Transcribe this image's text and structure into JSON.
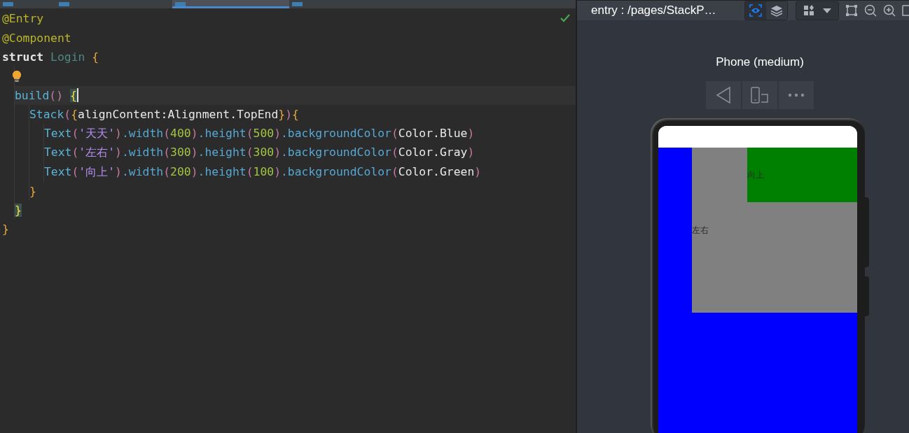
{
  "editor_tabs": [
    {
      "selected": false
    },
    {
      "selected": false
    },
    {
      "selected": true
    },
    {
      "selected": false
    }
  ],
  "code": {
    "valid": true,
    "lines": [
      {
        "tokens": [
          {
            "kind": "decorator",
            "text": "@Entry"
          }
        ]
      },
      {
        "tokens": [
          {
            "kind": "decorator",
            "text": "@Component"
          }
        ]
      },
      {
        "tokens": [
          {
            "kind": "keyword",
            "text": "struct "
          },
          {
            "kind": "type",
            "text": "Login "
          },
          {
            "kind": "brace",
            "text": "{"
          }
        ],
        "children": [
          {
            "kind": "hint"
          },
          {
            "current": true,
            "cursor": true,
            "tokens": [
              {
                "kind": "func",
                "text": "build"
              },
              {
                "kind": "paren",
                "text": "() "
              },
              {
                "kind": "match",
                "text": "{"
              }
            ],
            "children": [
              {
                "tokens": [
                  {
                    "kind": "func",
                    "text": "Stack"
                  },
                  {
                    "kind": "paren",
                    "text": "("
                  },
                  {
                    "kind": "brace",
                    "text": "{"
                  },
                  {
                    "kind": "plain",
                    "text": "alignContent:Alignment.TopEnd"
                  },
                  {
                    "kind": "brace",
                    "text": "}"
                  },
                  {
                    "kind": "paren",
                    "text": ")"
                  },
                  {
                    "kind": "brace",
                    "text": "{"
                  }
                ],
                "children": [
                  {
                    "tokens": [
                      {
                        "kind": "func",
                        "text": "Text"
                      },
                      {
                        "kind": "paren",
                        "text": "("
                      },
                      {
                        "kind": "string",
                        "text": "'天天'"
                      },
                      {
                        "kind": "paren",
                        "text": ")"
                      },
                      {
                        "kind": "method",
                        "text": ".width"
                      },
                      {
                        "kind": "paren",
                        "text": "("
                      },
                      {
                        "kind": "number",
                        "text": "400"
                      },
                      {
                        "kind": "paren",
                        "text": ")"
                      },
                      {
                        "kind": "method",
                        "text": ".height"
                      },
                      {
                        "kind": "paren",
                        "text": "("
                      },
                      {
                        "kind": "number",
                        "text": "500"
                      },
                      {
                        "kind": "paren",
                        "text": ")"
                      },
                      {
                        "kind": "method",
                        "text": ".backgroundColor"
                      },
                      {
                        "kind": "paren",
                        "text": "("
                      },
                      {
                        "kind": "plain",
                        "text": "Color.Blue"
                      },
                      {
                        "kind": "paren",
                        "text": ")"
                      }
                    ]
                  },
                  {
                    "tokens": [
                      {
                        "kind": "func",
                        "text": "Text"
                      },
                      {
                        "kind": "paren",
                        "text": "("
                      },
                      {
                        "kind": "string",
                        "text": "'左右'"
                      },
                      {
                        "kind": "paren",
                        "text": ")"
                      },
                      {
                        "kind": "method",
                        "text": ".width"
                      },
                      {
                        "kind": "paren",
                        "text": "("
                      },
                      {
                        "kind": "number",
                        "text": "300"
                      },
                      {
                        "kind": "paren",
                        "text": ")"
                      },
                      {
                        "kind": "method",
                        "text": ".height"
                      },
                      {
                        "kind": "paren",
                        "text": "("
                      },
                      {
                        "kind": "number",
                        "text": "300"
                      },
                      {
                        "kind": "paren",
                        "text": ")"
                      },
                      {
                        "kind": "method",
                        "text": ".backgroundColor"
                      },
                      {
                        "kind": "paren",
                        "text": "("
                      },
                      {
                        "kind": "plain",
                        "text": "Color.Gray"
                      },
                      {
                        "kind": "paren",
                        "text": ")"
                      }
                    ]
                  },
                  {
                    "tokens": [
                      {
                        "kind": "func",
                        "text": "Text"
                      },
                      {
                        "kind": "paren",
                        "text": "("
                      },
                      {
                        "kind": "string",
                        "text": "'向上'"
                      },
                      {
                        "kind": "paren",
                        "text": ")"
                      },
                      {
                        "kind": "method",
                        "text": ".width"
                      },
                      {
                        "kind": "paren",
                        "text": "("
                      },
                      {
                        "kind": "number",
                        "text": "200"
                      },
                      {
                        "kind": "paren",
                        "text": ")"
                      },
                      {
                        "kind": "method",
                        "text": ".height"
                      },
                      {
                        "kind": "paren",
                        "text": "("
                      },
                      {
                        "kind": "number",
                        "text": "100"
                      },
                      {
                        "kind": "paren",
                        "text": ")"
                      },
                      {
                        "kind": "method",
                        "text": ".backgroundColor"
                      },
                      {
                        "kind": "paren",
                        "text": "("
                      },
                      {
                        "kind": "plain",
                        "text": "Color.Green"
                      },
                      {
                        "kind": "paren",
                        "text": ")"
                      }
                    ]
                  }
                ]
              },
              {
                "tokens": [
                  {
                    "kind": "brace",
                    "text": "}"
                  }
                ]
              }
            ]
          },
          {
            "tokens": [
              {
                "kind": "match",
                "text": "}"
              }
            ]
          }
        ]
      },
      {
        "tokens": [
          {
            "kind": "brace",
            "text": "}"
          }
        ]
      }
    ]
  },
  "preview": {
    "title": "entry : /pages/StackP…",
    "inspect_on": true,
    "layers_on": false,
    "device": "Phone (medium)",
    "layers": [
      {
        "color": "#0000ff"
      },
      {
        "text": "左右",
        "color": "#808080"
      },
      {
        "text": "向上",
        "color": "#008000"
      }
    ]
  }
}
